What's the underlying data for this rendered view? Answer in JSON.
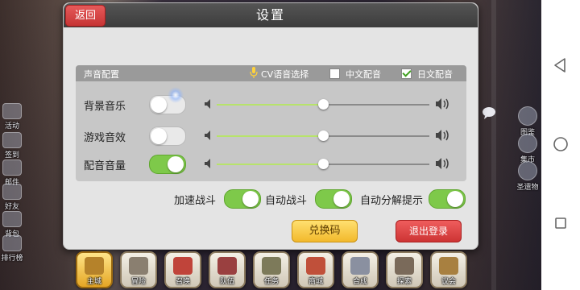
{
  "dialog": {
    "title": "设置",
    "back_label": "返回"
  },
  "sound": {
    "section_title": "声音配置",
    "cv_label": "CV语音选择",
    "cv_options": [
      {
        "label": "中文配音",
        "checked": false
      },
      {
        "label": "日文配音",
        "checked": true
      }
    ],
    "rows": [
      {
        "label": "背景音乐",
        "enabled": false,
        "level": 0.5
      },
      {
        "label": "游戏音效",
        "enabled": false,
        "level": 0.5
      },
      {
        "label": "配音音量",
        "enabled": true,
        "level": 0.5
      }
    ]
  },
  "options": [
    {
      "label": "加速战斗",
      "enabled": true
    },
    {
      "label": "自动战斗",
      "enabled": true
    },
    {
      "label": "自动分解提示",
      "enabled": true
    }
  ],
  "buttons": {
    "exchange_label": "兑换码",
    "logout_label": "退出登录"
  },
  "left_menu": [
    {
      "label": "活动",
      "icon": "activity-icon"
    },
    {
      "label": "签到",
      "icon": "calendar-icon"
    },
    {
      "label": "邮件",
      "icon": "mail-icon"
    },
    {
      "label": "好友",
      "icon": "friends-icon"
    },
    {
      "label": "背包",
      "icon": "bag-icon"
    },
    {
      "label": "排行榜",
      "icon": "ranking-icon"
    }
  ],
  "right_menu": [
    {
      "label": "图鉴",
      "icon": "codex-icon"
    },
    {
      "label": "集市",
      "icon": "market-icon"
    },
    {
      "label": "圣遗物",
      "icon": "relic-icon"
    }
  ],
  "bottom_menu": [
    {
      "label": "主城",
      "icon": "castle-icon",
      "active": true
    },
    {
      "label": "冒险",
      "icon": "swords-icon",
      "active": false
    },
    {
      "label": "召唤",
      "icon": "summon-icon",
      "active": false
    },
    {
      "label": "队伍",
      "icon": "team-icon",
      "active": false
    },
    {
      "label": "任务",
      "icon": "quest-book-icon",
      "active": false
    },
    {
      "label": "商城",
      "icon": "shop-icon",
      "active": false
    },
    {
      "label": "合成",
      "icon": "crafting-icon",
      "active": false
    },
    {
      "label": "探索",
      "icon": "explore-icon",
      "active": false
    },
    {
      "label": "议会",
      "icon": "council-icon",
      "active": false
    }
  ],
  "colors": {
    "toggle_on": "#7ec94a",
    "back_button": "#d94545",
    "exchange_button": "#f2b92c",
    "logout_button": "#cd3434",
    "slider_fill": "#b7e36b"
  }
}
